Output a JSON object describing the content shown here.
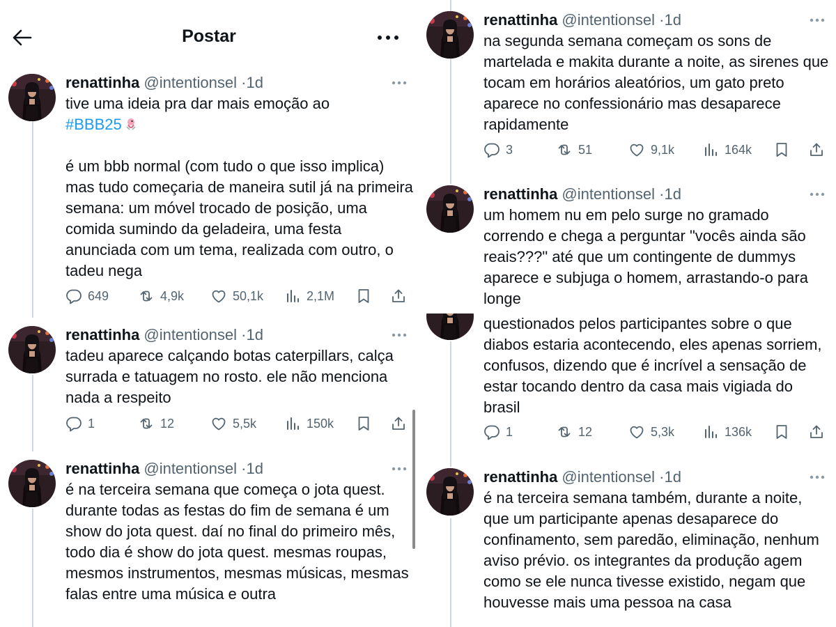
{
  "header": {
    "title": "Postar"
  },
  "author": {
    "name": "renattinha",
    "handle": "@intentionsel",
    "separator": "·",
    "time": "1d"
  },
  "tweets": [
    {
      "text_before": "tive uma ideia pra dar mais emoção ao\n",
      "hashtag": "#BBB25",
      "text_after": "\n\né um bbb normal (com tudo o que isso implica) mas tudo começaria de maneira sutil já na primeira semana: um móvel trocado de posição, uma comida sumindo da geladeira, uma festa anunciada com um tema, realizada com outro, o tadeu nega",
      "stats": {
        "replies": "649",
        "reposts": "4,9k",
        "likes": "50,1k",
        "views": "2,1M"
      }
    },
    {
      "text": "tadeu aparece calçando botas caterpillars, calça surrada e tatuagem no rosto. ele não menciona nada a respeito",
      "stats": {
        "replies": "1",
        "reposts": "12",
        "likes": "5,5k",
        "views": "150k"
      }
    },
    {
      "text": "é na terceira semana que começa o jota quest. durante todas as festas do fim de semana é um show do jota quest. daí no final do primeiro mês, todo dia é show do jota quest. mesmas roupas, mesmos instrumentos, mesmas músicas, mesmas falas entre uma música e outra"
    },
    {
      "text": "na segunda semana começam os sons de martelada e makita durante a noite, as sirenes que tocam em horários aleatórios, um gato preto aparece no confessionário mas desaparece rapidamente",
      "stats": {
        "replies": "3",
        "reposts": "51",
        "likes": "9,1k",
        "views": "164k"
      }
    },
    {
      "text": "um homem nu em pelo surge no gramado correndo e chega a perguntar \"vocês ainda são reais???\" até que um contingente de dummys aparece e subjuga o homem, arrastando-o para longe"
    },
    {
      "text": "questionados pelos participantes sobre o que diabos estaria acontecendo, eles apenas sorriem, confusos, dizendo que é incrível a sensação de estar tocando dentro da casa mais vigiada do brasil",
      "stats": {
        "replies": "1",
        "reposts": "12",
        "likes": "5,3k",
        "views": "136k"
      }
    },
    {
      "text": "é na terceira semana também, durante a noite, que um participante apenas desaparece do confinamento, sem paredão, eliminação, nenhum aviso prévio. os integrantes da produção agem como se ele nunca tivesse existido, negam que houvesse mais uma pessoa na casa"
    }
  ],
  "icons": {
    "back": "arrow-left-icon",
    "more": "more-horizontal-icon",
    "reply": "reply-icon",
    "repost": "repost-icon",
    "like": "heart-icon",
    "views": "views-icon",
    "bookmark": "bookmark-icon",
    "share": "share-icon"
  },
  "colors": {
    "link": "#1d9bf0",
    "muted": "#536471",
    "text": "#0f1419",
    "line": "#cfd9de"
  }
}
